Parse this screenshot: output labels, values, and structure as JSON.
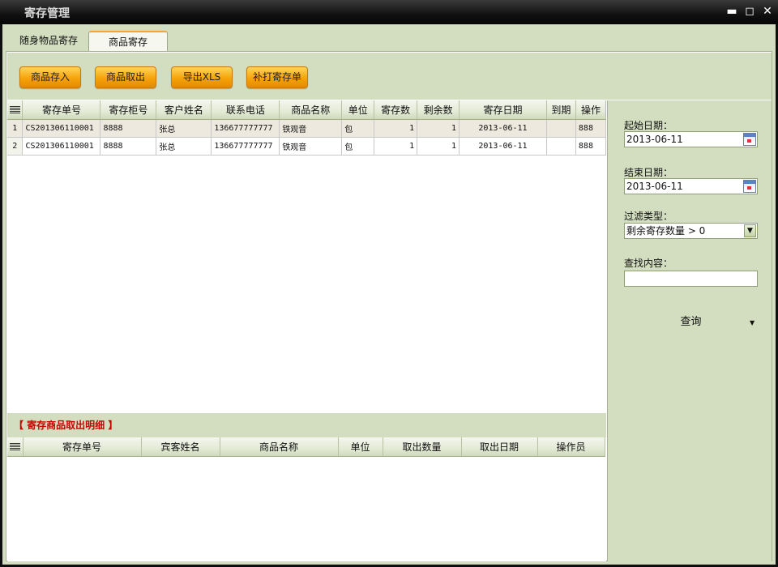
{
  "window": {
    "title": "寄存管理",
    "minimize": "▬",
    "maximize": "◻",
    "close": "✕"
  },
  "tabs": [
    {
      "label": "随身物品寄存"
    },
    {
      "label": "商品寄存"
    }
  ],
  "toolbar": {
    "deposit": "商品存入",
    "withdraw": "商品取出",
    "export": "导出XLS",
    "reprint": "补打寄存单"
  },
  "grid": {
    "columns": [
      "寄存单号",
      "寄存柜号",
      "客户姓名",
      "联系电话",
      "商品名称",
      "单位",
      "寄存数",
      "剩余数",
      "寄存日期",
      "到期",
      "操作"
    ],
    "rows": [
      {
        "no": "1",
        "cells": [
          "CS201306110001",
          "8888",
          "张总",
          "136677777777",
          "铁观音",
          "包",
          "1",
          "1",
          "2013-06-11",
          "",
          "888"
        ]
      },
      {
        "no": "2",
        "cells": [
          "CS201306110001",
          "8888",
          "张总",
          "136677777777",
          "铁观音",
          "包",
          "1",
          "1",
          "2013-06-11",
          "",
          "888"
        ]
      }
    ]
  },
  "detail": {
    "title": "【 寄存商品取出明细 】",
    "columns": [
      "寄存单号",
      "宾客姓名",
      "商品名称",
      "单位",
      "取出数量",
      "取出日期",
      "操作员"
    ]
  },
  "filter": {
    "start_label": "起始日期：",
    "start_value": "2013-06-11",
    "end_label": "结束日期：",
    "end_value": "2013-06-11",
    "type_label": "过滤类型：",
    "type_value": "剩余寄存数量 > 0",
    "search_label": "查找内容：",
    "search_value": "",
    "query": "查询",
    "query_arrow": "▼"
  }
}
